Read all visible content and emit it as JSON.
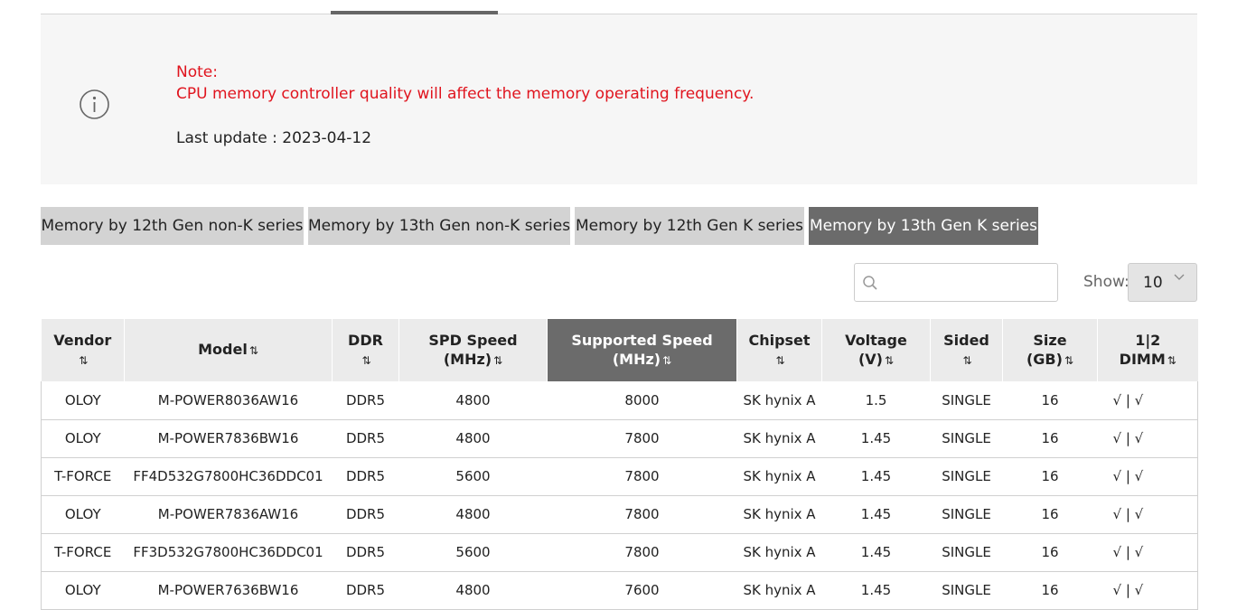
{
  "note": {
    "title": "Note:",
    "message": "CPU memory controller quality will affect the memory operating frequency.",
    "last_update": "Last update : 2023-04-12"
  },
  "tabs": [
    {
      "label": "Memory by 12th Gen non-K series",
      "active": false
    },
    {
      "label": "Memory by 13th Gen non-K series",
      "active": false
    },
    {
      "label": "Memory by 12th Gen K series",
      "active": false
    },
    {
      "label": "Memory by 13th Gen K series",
      "active": true
    }
  ],
  "search": {
    "placeholder": "",
    "value": ""
  },
  "show": {
    "label": "Show:",
    "value": "10"
  },
  "table": {
    "sort_icon": "⇅",
    "sorted_column": "Supported Speed (MHz)",
    "headers": [
      {
        "l1": "Vendor",
        "l2": ""
      },
      {
        "l1": "Model",
        "l2": ""
      },
      {
        "l1": "DDR",
        "l2": ""
      },
      {
        "l1": "SPD Speed",
        "l2": "(MHz)"
      },
      {
        "l1": "Supported Speed",
        "l2": "(MHz)"
      },
      {
        "l1": "Chipset",
        "l2": ""
      },
      {
        "l1": "Voltage",
        "l2": "(V)"
      },
      {
        "l1": "Sided",
        "l2": ""
      },
      {
        "l1": "Size",
        "l2": "(GB)"
      },
      {
        "l1": "1|2",
        "l2": "DIMM"
      }
    ],
    "rows": [
      [
        "OLOY",
        "M-POWER8036AW16",
        "DDR5",
        "4800",
        "8000",
        "SK hynix A",
        "1.5",
        "SINGLE",
        "16",
        "√ | √"
      ],
      [
        "OLOY",
        "M-POWER7836BW16",
        "DDR5",
        "4800",
        "7800",
        "SK hynix A",
        "1.45",
        "SINGLE",
        "16",
        "√ | √"
      ],
      [
        "T-FORCE",
        "FF4D532G7800HC36DDC01",
        "DDR5",
        "5600",
        "7800",
        "SK hynix A",
        "1.45",
        "SINGLE",
        "16",
        "√ | √"
      ],
      [
        "OLOY",
        "M-POWER7836AW16",
        "DDR5",
        "4800",
        "7800",
        "SK hynix A",
        "1.45",
        "SINGLE",
        "16",
        "√ | √"
      ],
      [
        "T-FORCE",
        "FF3D532G7800HC36DDC01",
        "DDR5",
        "5600",
        "7800",
        "SK hynix A",
        "1.45",
        "SINGLE",
        "16",
        "√ | √"
      ],
      [
        "OLOY",
        "M-POWER7636BW16",
        "DDR5",
        "4800",
        "7600",
        "SK hynix A",
        "1.45",
        "SINGLE",
        "16",
        "√ | √"
      ]
    ]
  },
  "colors": {
    "note_red": "#e0141e",
    "active_tab": "#6b6b6b",
    "inactive_tab": "#d3d3d3"
  }
}
